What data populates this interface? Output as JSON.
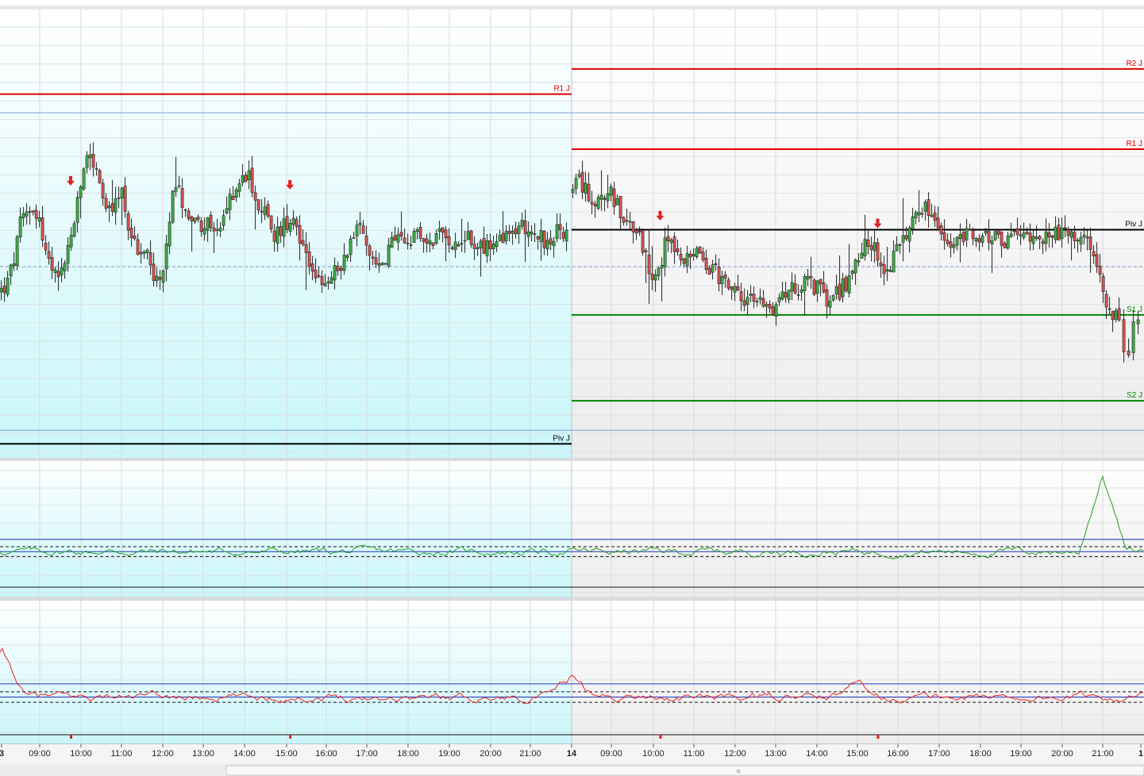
{
  "chart_data": {
    "type": "candlestick",
    "time_axis": {
      "labels": [
        "3",
        "09:00",
        "10:00",
        "11:00",
        "12:00",
        "13:00",
        "14:00",
        "15:00",
        "16:00",
        "17:00",
        "18:00",
        "19:00",
        "20:00",
        "21:00",
        "14",
        "09:00",
        "10:00",
        "11:00",
        "12:00",
        "13:00",
        "14:00",
        "15:00",
        "16:00",
        "17:00",
        "18:00",
        "19:00",
        "20:00",
        "21:00",
        "1"
      ],
      "bold_labels": [
        "3",
        "14",
        "1"
      ]
    },
    "days": [
      {
        "label": "3",
        "background": "#e6fbfd"
      },
      {
        "label": "14",
        "background": "#f4f4f4"
      }
    ],
    "price_panel": {
      "ylim": [
        0,
        100
      ],
      "pivot_levels": [
        {
          "day": "3",
          "label": "R1 J",
          "value": 88.8,
          "color": "#dd0000"
        },
        {
          "day": "3",
          "label": "Piv J",
          "value": -1.5,
          "color": "#000000"
        },
        {
          "day": "14",
          "label": "R2 J",
          "value": 95.3,
          "color": "#dd0000"
        },
        {
          "day": "14",
          "label": "R1 J",
          "value": 74.6,
          "color": "#dd0000"
        },
        {
          "day": "14",
          "label": "Piv J",
          "value": 53.8,
          "color": "#000000"
        },
        {
          "day": "14",
          "label": "S1 J",
          "value": 31.8,
          "color": "#008800"
        },
        {
          "day": "14",
          "label": "S2 J",
          "value": 9.6,
          "color": "#008800"
        }
      ],
      "horizontal_guides": [
        84.0,
        2.0
      ],
      "dashed_guide": 44.3,
      "signal_arrows": [
        {
          "day": "3",
          "time": "09:45",
          "value": 66
        },
        {
          "day": "3",
          "time": "15:05",
          "value": 65
        },
        {
          "day": "14",
          "time": "10:10",
          "value": 57
        },
        {
          "day": "14",
          "time": "15:30",
          "value": 55
        }
      ],
      "series": [
        {
          "name": "day3",
          "day": "3",
          "anchors": [
            [
              0,
              38
            ],
            [
              8,
              40
            ],
            [
              16,
              46
            ],
            [
              24,
              55
            ],
            [
              32,
              58
            ],
            [
              40,
              60
            ],
            [
              48,
              56
            ],
            [
              56,
              48
            ],
            [
              64,
              43
            ],
            [
              72,
              40
            ],
            [
              80,
              46
            ],
            [
              88,
              52
            ],
            [
              96,
              60
            ],
            [
              104,
              70
            ],
            [
              112,
              74
            ],
            [
              120,
              68
            ],
            [
              128,
              62
            ],
            [
              136,
              58
            ],
            [
              144,
              60
            ],
            [
              152,
              64
            ],
            [
              160,
              55
            ],
            [
              168,
              50
            ],
            [
              176,
              47
            ],
            [
              184,
              48
            ],
            [
              192,
              42
            ],
            [
              200,
              40
            ],
            [
              208,
              48
            ],
            [
              216,
              62
            ],
            [
              224,
              63
            ],
            [
              232,
              60
            ],
            [
              240,
              57
            ],
            [
              248,
              55
            ],
            [
              256,
              56
            ],
            [
              264,
              55
            ],
            [
              272,
              52
            ],
            [
              280,
              56
            ],
            [
              288,
              62
            ],
            [
              296,
              65
            ],
            [
              304,
              67
            ],
            [
              312,
              69
            ],
            [
              320,
              62
            ],
            [
              328,
              60
            ],
            [
              336,
              56
            ],
            [
              344,
              52
            ],
            [
              352,
              54
            ],
            [
              360,
              56
            ],
            [
              368,
              58
            ],
            [
              376,
              52
            ],
            [
              384,
              48
            ],
            [
              392,
              44
            ],
            [
              400,
              40
            ],
            [
              408,
              38
            ],
            [
              416,
              42
            ],
            [
              424,
              44
            ],
            [
              432,
              46
            ],
            [
              440,
              52
            ],
            [
              448,
              54
            ],
            [
              456,
              55
            ],
            [
              464,
              47
            ],
            [
              472,
              46
            ],
            [
              480,
              45
            ],
            [
              488,
              49
            ],
            [
              496,
              51
            ],
            [
              504,
              51
            ],
            [
              512,
              50
            ],
            [
              520,
              52
            ],
            [
              528,
              52
            ],
            [
              536,
              50
            ],
            [
              544,
              51
            ],
            [
              552,
              52
            ],
            [
              560,
              52
            ],
            [
              568,
              51
            ],
            [
              576,
              51
            ],
            [
              584,
              52
            ],
            [
              592,
              51
            ],
            [
              600,
              50
            ],
            [
              608,
              49
            ],
            [
              616,
              49
            ],
            [
              624,
              50
            ],
            [
              632,
              51
            ],
            [
              640,
              52
            ],
            [
              648,
              54
            ],
            [
              656,
              55
            ],
            [
              664,
              54
            ],
            [
              672,
              53
            ],
            [
              680,
              52
            ],
            [
              688,
              50
            ],
            [
              696,
              52
            ],
            [
              704,
              54
            ],
            [
              712,
              52
            ],
            [
              718,
              50
            ]
          ]
        },
        {
          "name": "day14",
          "day": "14",
          "anchors": [
            [
              720,
              64
            ],
            [
              728,
              66
            ],
            [
              736,
              64
            ],
            [
              744,
              62
            ],
            [
              752,
              62
            ],
            [
              760,
              61
            ],
            [
              768,
              63
            ],
            [
              776,
              60
            ],
            [
              784,
              56
            ],
            [
              792,
              55
            ],
            [
              800,
              54
            ],
            [
              808,
              50
            ],
            [
              816,
              44
            ],
            [
              824,
              42
            ],
            [
              832,
              46
            ],
            [
              840,
              53
            ],
            [
              848,
              50
            ],
            [
              856,
              44
            ],
            [
              864,
              48
            ],
            [
              872,
              49
            ],
            [
              880,
              46
            ],
            [
              888,
              45
            ],
            [
              896,
              44
            ],
            [
              904,
              42
            ],
            [
              912,
              40
            ],
            [
              920,
              38
            ],
            [
              928,
              37
            ],
            [
              936,
              36
            ],
            [
              944,
              35
            ],
            [
              952,
              35
            ],
            [
              960,
              35
            ],
            [
              968,
              33
            ],
            [
              976,
              35
            ],
            [
              984,
              37
            ],
            [
              992,
              39
            ],
            [
              1000,
              38
            ],
            [
              1008,
              40
            ],
            [
              1016,
              40
            ],
            [
              1024,
              39
            ],
            [
              1032,
              38
            ],
            [
              1040,
              35
            ],
            [
              1048,
              36
            ],
            [
              1056,
              38
            ],
            [
              1064,
              40
            ],
            [
              1072,
              41
            ],
            [
              1080,
              48
            ],
            [
              1088,
              52
            ],
            [
              1096,
              50
            ],
            [
              1104,
              47
            ],
            [
              1112,
              44
            ],
            [
              1120,
              45
            ],
            [
              1128,
              48
            ],
            [
              1136,
              52
            ],
            [
              1144,
              55
            ],
            [
              1152,
              58
            ],
            [
              1160,
              60
            ],
            [
              1168,
              58
            ],
            [
              1176,
              56
            ],
            [
              1184,
              52
            ],
            [
              1192,
              50
            ],
            [
              1200,
              50
            ],
            [
              1208,
              51
            ],
            [
              1216,
              52
            ],
            [
              1224,
              52
            ],
            [
              1232,
              51
            ],
            [
              1240,
              52
            ],
            [
              1248,
              52
            ],
            [
              1256,
              51
            ],
            [
              1264,
              51
            ],
            [
              1272,
              52
            ],
            [
              1280,
              52
            ],
            [
              1288,
              52
            ],
            [
              1296,
              53
            ],
            [
              1304,
              53
            ],
            [
              1312,
              52
            ],
            [
              1320,
              52
            ],
            [
              1328,
              53
            ],
            [
              1336,
              53
            ],
            [
              1344,
              52
            ],
            [
              1352,
              52
            ],
            [
              1360,
              51
            ],
            [
              1368,
              50
            ],
            [
              1376,
              45
            ],
            [
              1384,
              42
            ],
            [
              1392,
              36
            ],
            [
              1400,
              32
            ],
            [
              1408,
              32
            ],
            [
              1414,
              24
            ],
            [
              1420,
              22
            ],
            [
              1426,
              28
            ],
            [
              1432,
              30
            ],
            [
              1438,
              33
            ]
          ]
        }
      ]
    },
    "oscillator_1": {
      "color": "#22a022",
      "ylim": [
        0,
        100
      ],
      "band_lines_solid": [
        70,
        50
      ],
      "band_lines_dashed": [
        58,
        42
      ],
      "spike": {
        "day": "14",
        "time": "21:00",
        "value": 175
      },
      "baseline": 50
    },
    "oscillator_2": {
      "color": "#ee2222",
      "ylim": [
        0,
        100
      ],
      "band_lines_solid": [
        70,
        50
      ],
      "band_lines_dashed": [
        58,
        42
      ],
      "spikes": [
        {
          "day": "3",
          "time": "08:00",
          "value": 120
        },
        {
          "day": "14",
          "time": "08:00",
          "value": 80
        },
        {
          "day": "14",
          "time": "15:05",
          "value": 75
        }
      ],
      "baseline": 50
    },
    "xlabel": "",
    "ylabel": ""
  }
}
